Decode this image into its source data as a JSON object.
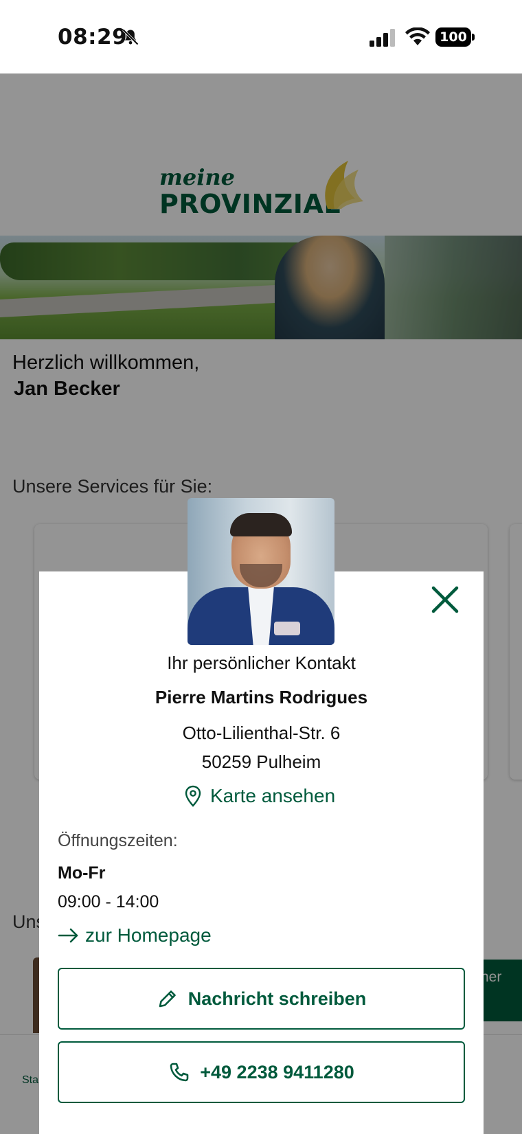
{
  "status_bar": {
    "time": "08:29",
    "battery": "100"
  },
  "brand": {
    "line1": "meine",
    "line2": "PROVINZIAL"
  },
  "home": {
    "welcome": "Herzlich willkommen,",
    "user_name": "Jan Becker",
    "services_heading": "Unsere Services für Sie:",
    "section_2_heading": "Uns",
    "teaser_button_label": "her",
    "nav_item_label": "Sta"
  },
  "contact_modal": {
    "title": "Ihr persönlicher Kontakt",
    "name": "Pierre Martins Rodrigues",
    "street": "Otto-Lilienthal-Str. 6",
    "city": "50259 Pulheim",
    "map_link": "Karte ansehen",
    "hours_label": "Öffnungszeiten:",
    "hours_days": "Mo-Fr",
    "hours_time": "09:00 - 14:00",
    "homepage_link": "zur Homepage",
    "message_button": "Nachricht schreiben",
    "phone_button": "+49 2238 9411280"
  },
  "colors": {
    "brand_green": "#005a3c",
    "brand_gold": "#e0c23a",
    "overlay": "rgba(0,0,0,0.42)"
  },
  "icons": {
    "bell": "bell-slash-icon",
    "close": "close-icon",
    "map": "map-pin-icon",
    "homepage": "arrow-right-icon",
    "message": "pencil-icon",
    "phone": "phone-icon"
  }
}
